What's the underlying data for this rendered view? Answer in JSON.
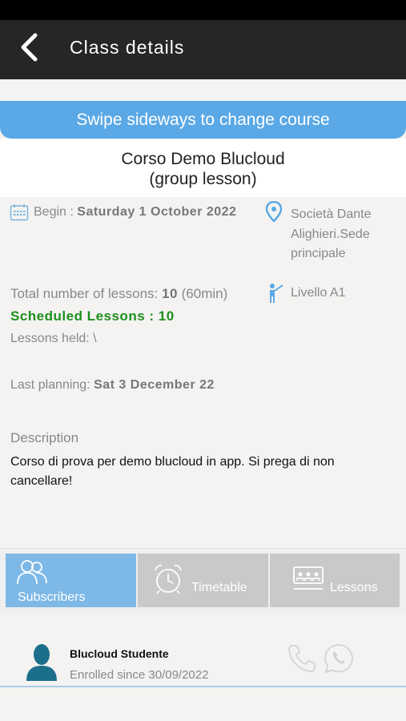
{
  "header": {
    "title": "Class details"
  },
  "banner": {
    "text": "Swipe sideways to change course"
  },
  "course": {
    "name": "Corso Demo Blucloud",
    "type": "(group lesson)"
  },
  "details": {
    "begin_label": "Begin : ",
    "begin_value": "Saturday 1 October 2022",
    "location": "Società Dante Alighieri.Sede principale",
    "total_label": "Total number of lessons: ",
    "total_value": "10",
    "total_duration": " (60min)",
    "level": "Livello A1",
    "scheduled": "Scheduled Lessons : 10",
    "held": "Lessons held: \\",
    "planning_label": "Last planning: ",
    "planning_value": "Sat 3 December 22",
    "description_label": "Description",
    "description_text": "Corso di prova per demo blucloud in app. Si prega di non cancellare!"
  },
  "tabs": [
    {
      "label": "Subscribers",
      "icon": "people-icon",
      "active": true
    },
    {
      "label": "Timetable",
      "icon": "alarm-clock-icon",
      "active": false
    },
    {
      "label": "Lessons",
      "icon": "classroom-icon",
      "active": false
    }
  ],
  "subscribers": [
    {
      "name": "Blucloud Studente",
      "since": "Enrolled since 30/09/2022"
    }
  ],
  "colors": {
    "accent": "#5aa9e6",
    "active_tab": "#7db8e6",
    "scheduled_green": "#1e8f1e",
    "header": "#262626"
  }
}
